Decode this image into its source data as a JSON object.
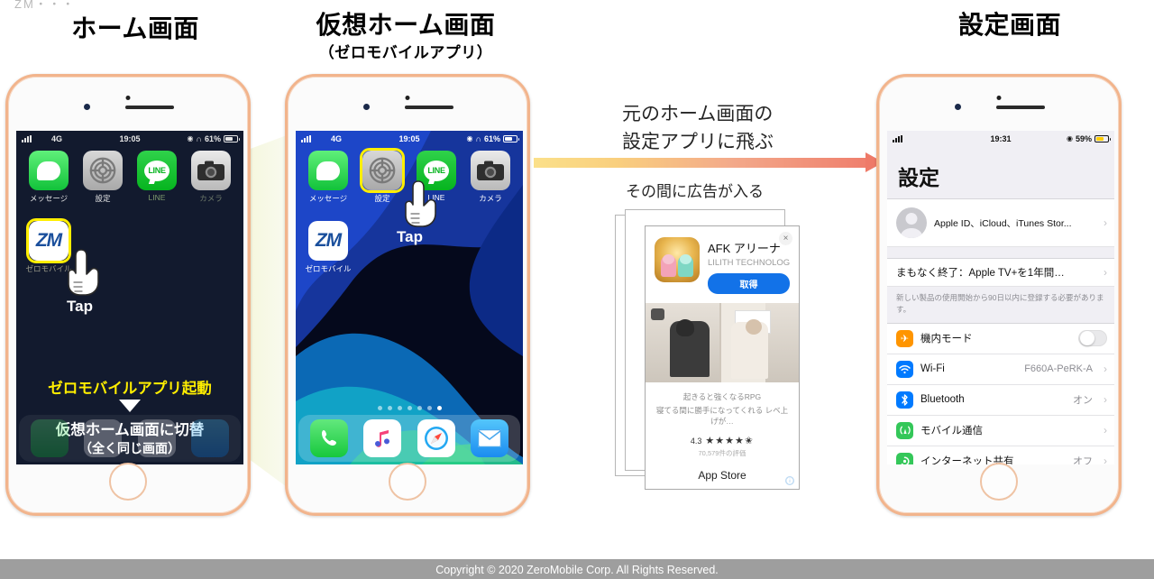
{
  "captions": {
    "cut_top": "ZM・・・",
    "home": "ホーム画面",
    "virtual": "仮想ホーム画面",
    "virtual_sub": "（ゼロモバイルアプリ）",
    "settings": "設定画面"
  },
  "phone1": {
    "status": {
      "network": "4G",
      "time": "19:05",
      "battery_pct": "61%",
      "icons": "location headphones"
    },
    "apps": [
      {
        "name": "メッセージ",
        "icon": "messages-icon"
      },
      {
        "name": "設定",
        "icon": "settings-gear-icon"
      },
      {
        "name": "LINE",
        "icon": "line-icon",
        "label": "LINE"
      },
      {
        "name": "カメラ",
        "icon": "camera-icon"
      },
      {
        "name": "ゼロモバイル",
        "icon": "zeromobile-icon",
        "label": "ZM"
      }
    ],
    "tap_label": "Tap",
    "overlay_line1": "ゼロモバイルアプリ起動",
    "overlay_line2": "仮想ホーム画面に切替",
    "overlay_line3": "（全く同じ画面）"
  },
  "phone2": {
    "status": {
      "network": "4G",
      "time": "19:05",
      "battery_pct": "61%"
    },
    "apps": [
      {
        "name": "メッセージ",
        "icon": "messages-icon"
      },
      {
        "name": "設定",
        "icon": "settings-gear-icon"
      },
      {
        "name": "LINE",
        "icon": "line-icon",
        "label": "LINE"
      },
      {
        "name": "カメラ",
        "icon": "camera-icon"
      },
      {
        "name": "ゼロモバイル",
        "icon": "zeromobile-icon",
        "label": "ZM"
      }
    ],
    "tap_label": "Tap",
    "dock": [
      {
        "name": "電話",
        "icon": "phone-icon"
      },
      {
        "name": "ミュージック",
        "icon": "music-icon"
      },
      {
        "name": "Safari",
        "icon": "safari-icon"
      },
      {
        "name": "メール",
        "icon": "mail-icon"
      }
    ]
  },
  "middle": {
    "headline_line1": "元のホーム画面の",
    "headline_line2": "設定アプリに飛ぶ",
    "subline": "その間に広告が入る",
    "arrow_color_start": "#fbe08a",
    "arrow_color_end": "#ee7a68"
  },
  "ad": {
    "close_label": "×",
    "title": "AFK アリーナ",
    "developer": "LILITH TECHNOLOGY...",
    "get_button": "取得",
    "desc_line1": "起きると強くなるRPG",
    "desc_line2": "寝てる間に勝手になってくれる レベ上げが…",
    "rating": "4.3",
    "stars": "★★★★✬",
    "rating_count": "70,579件の評価",
    "store": "App Store",
    "info_badge": "ⓘ"
  },
  "settings": {
    "status": {
      "time": "19:31",
      "battery_pct": "59%",
      "battery_color": "#ffcc00"
    },
    "title": "設定",
    "account_row": {
      "label": "Apple ID、iCloud、iTunes Stor...",
      "chevron": "›"
    },
    "promo_row": {
      "label": "まもなく終了：Apple TV+を1年間…",
      "chevron": "›"
    },
    "promo_note": "新しい製品の使用開始から90日以内に登録する必要があります。",
    "rows": [
      {
        "icon": "airplane-icon",
        "glyph": "✈",
        "label": "機内モード",
        "value": "",
        "control": "toggle",
        "on": false
      },
      {
        "icon": "wifi-icon",
        "glyph": "≋",
        "label": "Wi-Fi",
        "value": "F660A-PeRK-A",
        "control": "chevron"
      },
      {
        "icon": "bluetooth-icon",
        "glyph": "✣",
        "label": "Bluetooth",
        "value": "オン",
        "control": "chevron"
      },
      {
        "icon": "cellular-icon",
        "glyph": "((¡))",
        "label": "モバイル通信",
        "value": "",
        "control": "chevron"
      },
      {
        "icon": "hotspot-icon",
        "glyph": "◉",
        "label": "インターネット共有",
        "value": "オフ",
        "control": "chevron"
      }
    ],
    "chevron": "›"
  },
  "footer": {
    "text": "Copyright © 2020 ZeroMobile Corp. All Rights Reserved."
  }
}
